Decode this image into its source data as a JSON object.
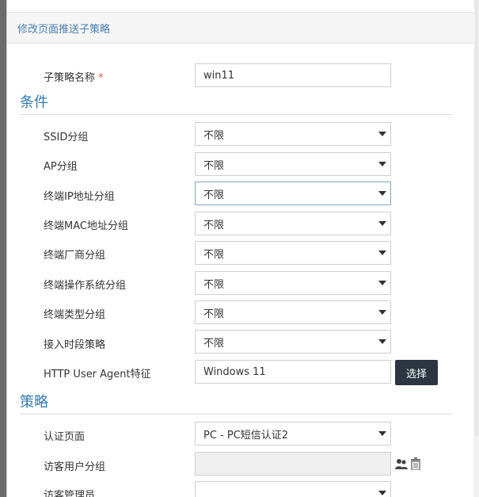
{
  "header": {
    "title": "修改页面推送子策略"
  },
  "name_field": {
    "label": "子策略名称",
    "required_mark": "*",
    "value": "win11"
  },
  "conditions": {
    "title": "条件",
    "rows": [
      {
        "label": "SSID分组",
        "value": "不限"
      },
      {
        "label": "AP分组",
        "value": "不限"
      },
      {
        "label": "终端IP地址分组",
        "value": "不限"
      },
      {
        "label": "终端MAC地址分组",
        "value": "不限"
      },
      {
        "label": "终端厂商分组",
        "value": "不限"
      },
      {
        "label": "终端操作系统分组",
        "value": "不限"
      },
      {
        "label": "终端类型分组",
        "value": "不限"
      },
      {
        "label": "接入时段策略",
        "value": "不限"
      }
    ],
    "user_agent": {
      "label": "HTTP User Agent特征",
      "value": "Windows 11",
      "button_label": "选择"
    }
  },
  "policy": {
    "title": "策略",
    "auth_page": {
      "label": "认证页面",
      "value": "PC - PC短信认证2"
    },
    "guest_group": {
      "label": "访客用户分组",
      "value": ""
    },
    "guest_admin": {
      "label": "访客管理员",
      "value": ""
    }
  },
  "icons": {
    "group_icon": "users-icon",
    "delete_icon": "trash-icon"
  }
}
